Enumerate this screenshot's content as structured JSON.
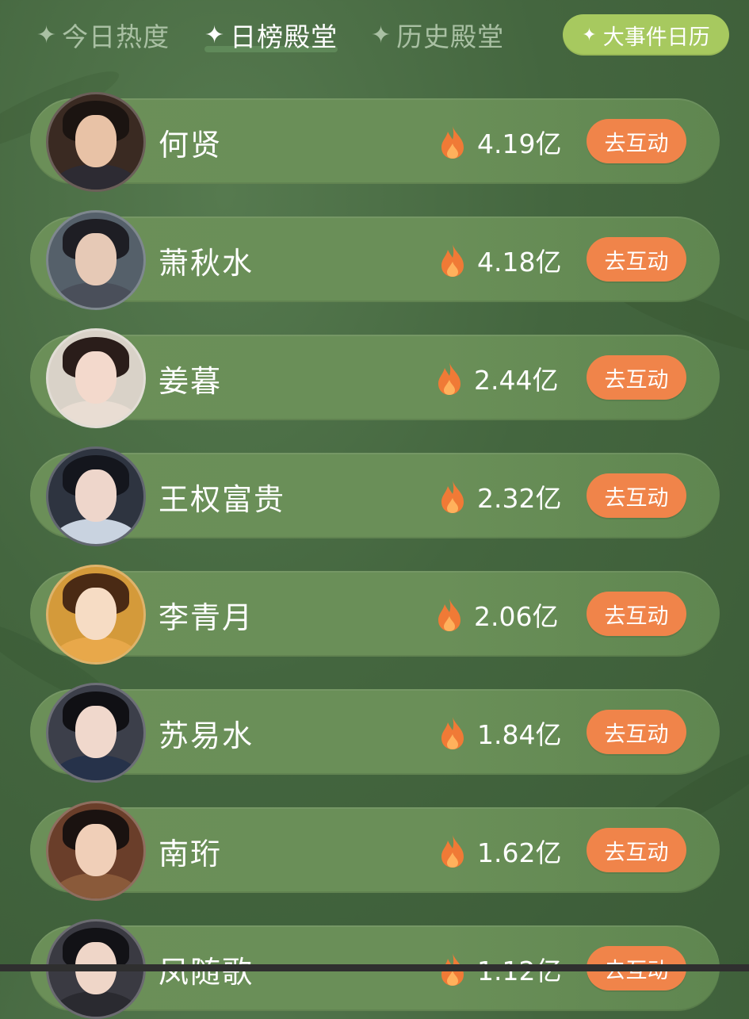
{
  "tabs": [
    {
      "label": "今日热度",
      "active": false
    },
    {
      "label": "日榜殿堂",
      "active": true
    },
    {
      "label": "历史殿堂",
      "active": false
    }
  ],
  "event_calendar_label": "大事件日历",
  "colors": {
    "background": "#44663f",
    "row": "#6a8f58",
    "action_button": "#f0844a",
    "calendar_button": "#a7c95f",
    "flame": "#f07a36"
  },
  "ranking": [
    {
      "name": "何贤",
      "heat": "4.19亿",
      "action": "去互动"
    },
    {
      "name": "萧秋水",
      "heat": "4.18亿",
      "action": "去互动"
    },
    {
      "name": "姜暮",
      "heat": "2.44亿",
      "action": "去互动"
    },
    {
      "name": "王权富贵",
      "heat": "2.32亿",
      "action": "去互动"
    },
    {
      "name": "李青月",
      "heat": "2.06亿",
      "action": "去互动"
    },
    {
      "name": "苏易水",
      "heat": "1.84亿",
      "action": "去互动"
    },
    {
      "name": "南珩",
      "heat": "1.62亿",
      "action": "去互动"
    },
    {
      "name": "凤随歌",
      "heat": "1.12亿",
      "action": "去互动"
    }
  ]
}
